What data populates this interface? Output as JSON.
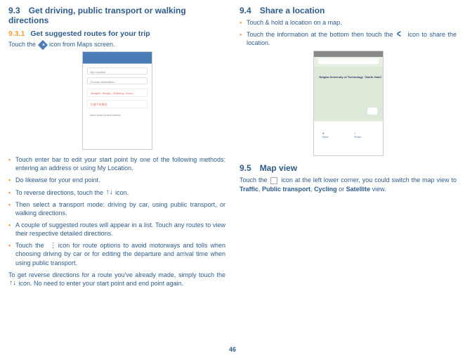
{
  "page_number": "46",
  "left": {
    "h93_num": "9.3",
    "h93_title": "Get driving, public transport or walking directions",
    "h931_num": "9.3.1",
    "h931_title": "Get suggested routes for your trip",
    "touch_icon_text_a": "Touch the ",
    "touch_icon_text_b": " icon from Maps screen.",
    "bullets": [
      "Touch enter bar to edit your start point by one of the following methods: entering an address or using My Location.",
      "Do likewise for your end point.",
      "To reverse directions, touch the ",
      " icon.",
      "Then select a transport mode: driving by car, using public transport, or walking directions.",
      "A couple of suggested routes will appear in a list. Touch any routes to view their respective detailed directions.",
      "Touch the ",
      " icon for route options to avoid motorways and tolls when choosing driving by car or for editing the departure and arrival time when using public transport."
    ],
    "footer_a": "To get reverse directions for a route you've already made, simply touch the ",
    "footer_b": " icon. No need to enter your start point and end point again."
  },
  "right": {
    "h94_num": "9.4",
    "h94_title": "Share a location",
    "bullets94": [
      "Touch & hold a location on a map.",
      "Touch the information at the bottom then touch the ",
      " icon to share the location."
    ],
    "sc2_label": "Ningbo University of Technology（North Gate）",
    "sc2_save": "Save",
    "sc2_share": "Share",
    "h95_num": "9.5",
    "h95_title": "Map view",
    "body95_a": "Touch the ",
    "body95_b": " icon at the left lower corner, you could switch the map view to ",
    "body95_c": "Traffic",
    "body95_d": ", ",
    "body95_e": "Public transport",
    "body95_f": ", ",
    "body95_g": "Cycling",
    "body95_h": " or ",
    "body95_i": "Satellite",
    "body95_j": " view."
  },
  "sc1": {
    "my_location": "My Location",
    "choose": "Choose destination...",
    "item1": "Jiangbei, Ningbo, Zhejiang, China...",
    "item2": "宁波汽车南站",
    "more": "View more recent history"
  }
}
